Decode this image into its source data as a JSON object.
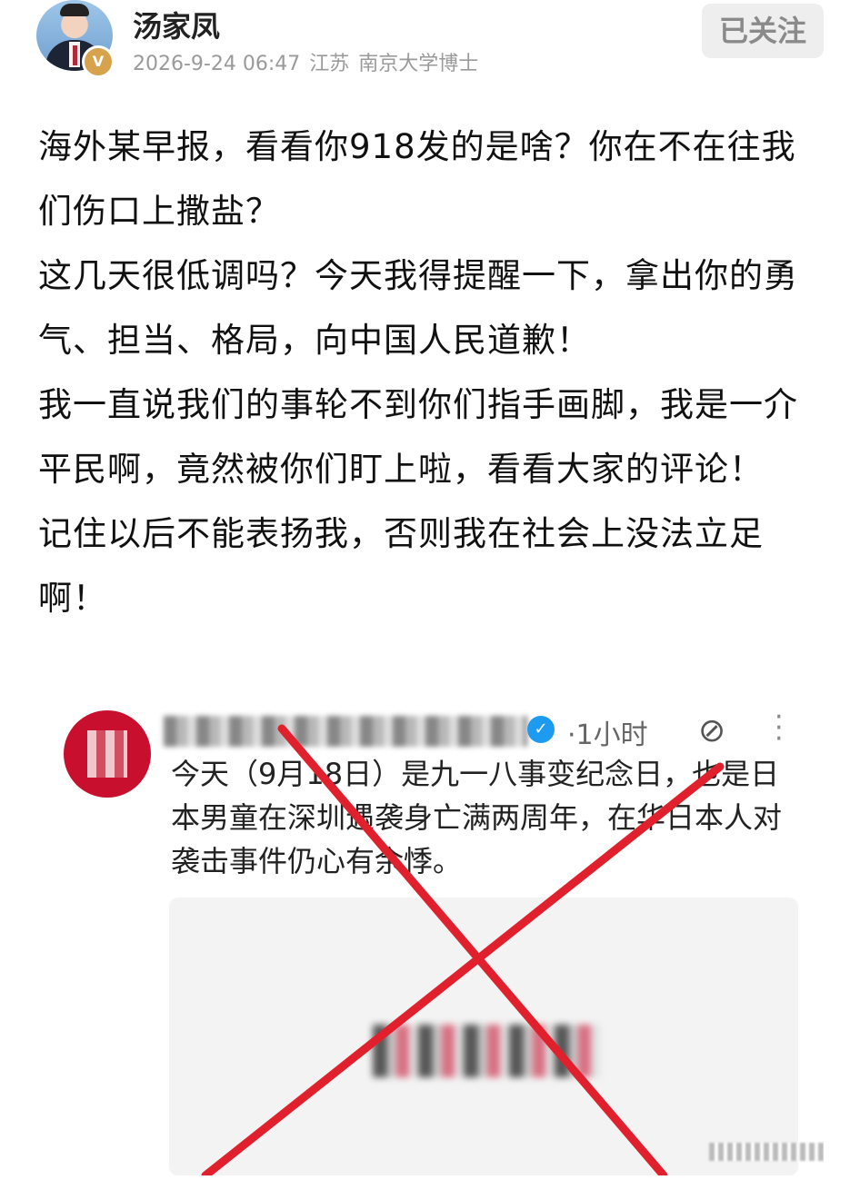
{
  "header": {
    "username": "汤家凤",
    "verified_badge": "V",
    "date_time": "2026-9-24 06:47",
    "location": "江苏",
    "title": "南京大学博士",
    "follow_label": "已关注"
  },
  "post": {
    "paragraphs": [
      "海外某早报，看看你918发的是啥？你在不在往我们伤口上撒盐？",
      "这几天很低调吗？今天我得提醒一下，拿出你的勇气、担当、格局，向中国人民道歉！",
      "我一直说我们的事轮不到你们指手画脚，我是一介平民啊，竟然被你们盯上啦，看看大家的评论！",
      "记住以后不能表扬我，否则我在社会上没法立足啊！"
    ]
  },
  "embedded_post": {
    "time": "·1小时",
    "text": "今天（9月18日）是九一八事变纪念日，也是日本男童在深圳遇袭身亡满两周年，在华日本人对袭击事件仍心有余悸。",
    "icons": [
      "verified-icon",
      "grok-icon",
      "more-icon"
    ],
    "cross_color": "#e0212d"
  }
}
